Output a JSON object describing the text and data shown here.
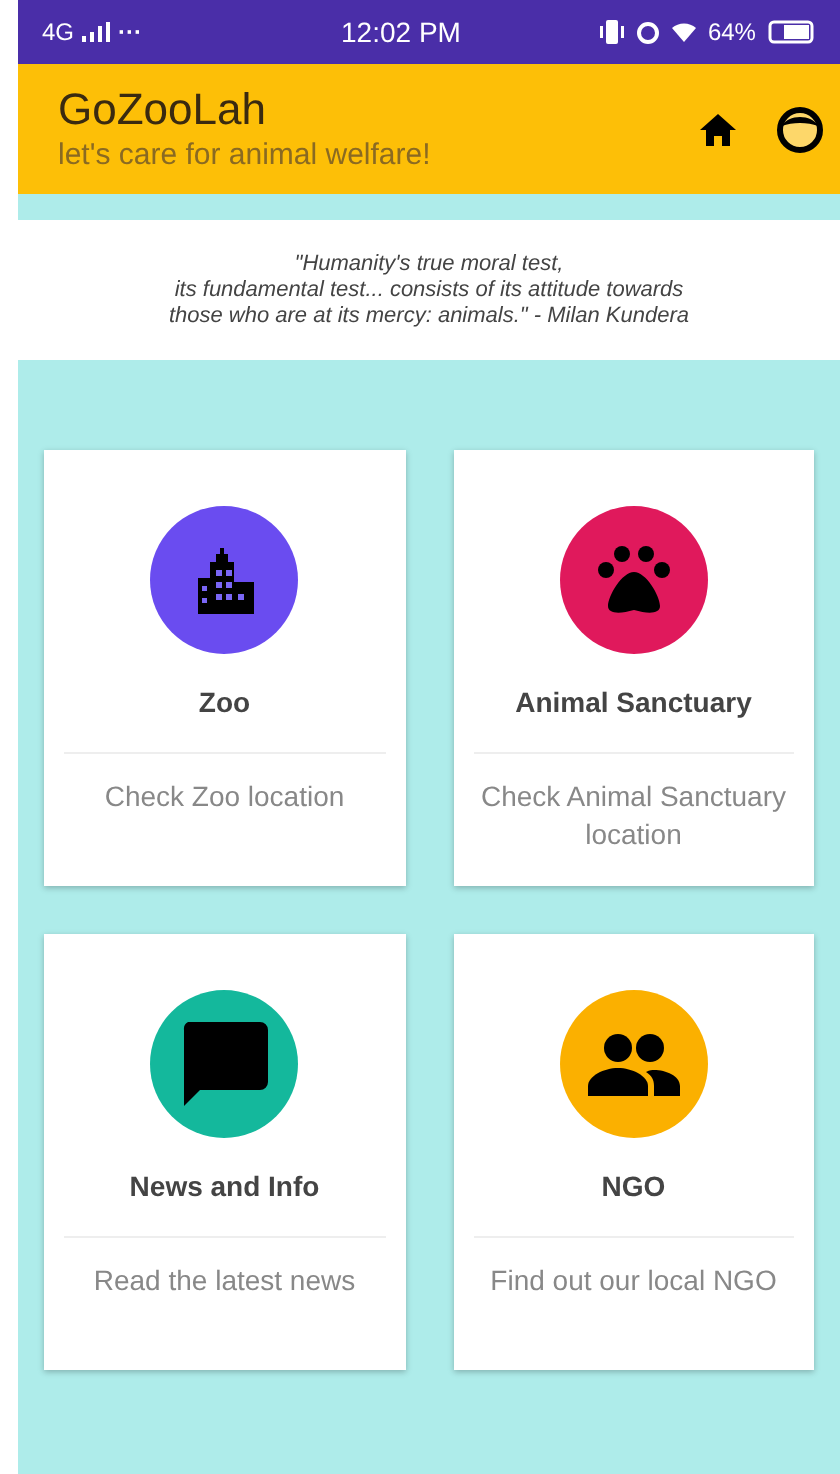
{
  "status_bar": {
    "network": "4G",
    "dots": "···",
    "time": "12:02 PM",
    "battery": "64%"
  },
  "header": {
    "title": "GoZooLah",
    "subtitle": "let's care for animal welfare!"
  },
  "quote_lines": [
    "\"Humanity's true moral test,",
    "its fundamental test... consists of its attitude towards",
    "those who are at its mercy: animals.\" - Milan Kundera"
  ],
  "cards": [
    {
      "kind": "zoo",
      "color": "#6a4cf0",
      "title": "Zoo",
      "description": "Check Zoo location"
    },
    {
      "kind": "sanctuary",
      "color": "#e0195c",
      "title": "Animal Sanctuary",
      "description": "Check Animal Sanctuary location"
    },
    {
      "kind": "news",
      "color": "#14b89c",
      "title": "News and Info",
      "description": "Read the latest news"
    },
    {
      "kind": "ngo",
      "color": "#fbb000",
      "title": "NGO",
      "description": "Find out our local NGO"
    }
  ]
}
